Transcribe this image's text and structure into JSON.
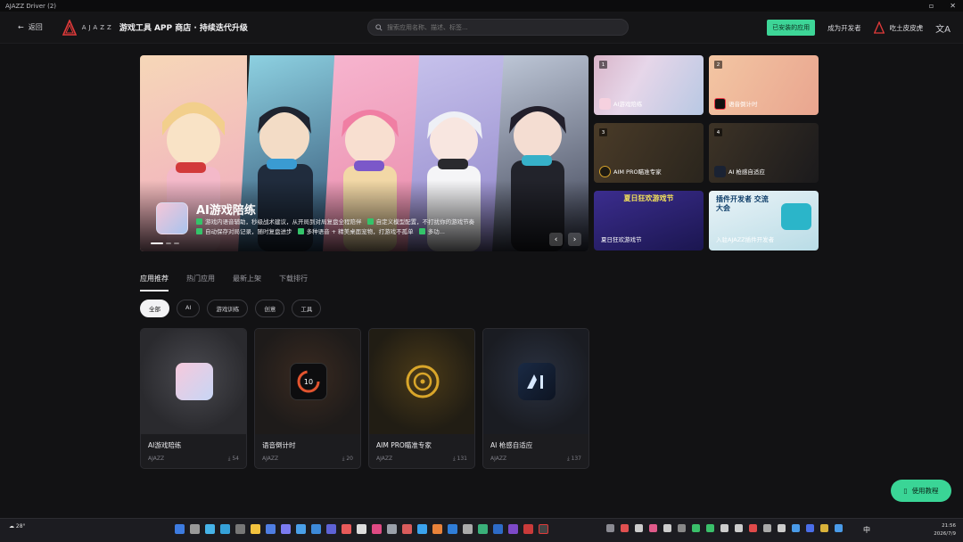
{
  "window": {
    "title": "AJAZZ Driver (2)",
    "controls": [
      "▫",
      "✕"
    ]
  },
  "header": {
    "back_label": "返回",
    "logo_word": "AJAZZ",
    "title": "游戏工具 APP 商店 · 持续迭代升级",
    "search_placeholder": "搜索应用名称、描述、标签...",
    "installed_label": "已安装的应用",
    "dev_label": "成为开发者",
    "user_name": "吃土皮皮虎",
    "lang_icon": "文A"
  },
  "hero": {
    "app_name": "AI游戏陪练",
    "features": [
      "游戏内语音辅助，秒级战术建议，从开局到对局复盘全程陪伴",
      "自定义模型配置，不打扰你的游戏节奏",
      "自动保存对局记录，随时复盘进步",
      "多种语音 + 精美桌面宠物，打游戏不孤单",
      "多功..."
    ],
    "prev_icon": "‹",
    "next_icon": "›",
    "colors": [
      "#f3c8cf",
      "#86c3d6",
      "#f2a9c4",
      "#c8b6e6",
      "#9fb2cc"
    ]
  },
  "side_cards": [
    {
      "index": "1",
      "label": "AI游戏陪练"
    },
    {
      "index": "2",
      "label": "语音倒计时"
    },
    {
      "index": "3",
      "label": "AIM PRO瞄准专家"
    },
    {
      "index": "4",
      "label": "AI 枪感自适应"
    },
    {
      "index": "",
      "label": "夏日狂欢游戏节",
      "banner": "夏日狂欢游戏节"
    },
    {
      "index": "",
      "label": "入驻AJAZZ插件开发者",
      "banner": "插件开发者 交流大会"
    }
  ],
  "tabs": [
    "应用推荐",
    "热门应用",
    "最新上架",
    "下载排行"
  ],
  "chips": [
    "全部",
    "AI",
    "游戏训练",
    "创意",
    "工具"
  ],
  "apps": [
    {
      "name": "AI游戏陪练",
      "publisher": "AJAZZ",
      "downloads": "54"
    },
    {
      "name": "语音倒计时",
      "publisher": "AJAZZ",
      "downloads": "20"
    },
    {
      "name": "AIM PRO瞄准专家",
      "publisher": "AJAZZ",
      "downloads": "131"
    },
    {
      "name": "AI 枪感自适应",
      "publisher": "AJAZZ",
      "downloads": "137"
    }
  ],
  "help_label": "使用教程",
  "taskbar": {
    "weather": "28°",
    "ime": "中",
    "clock_time": "21:56",
    "clock_date": "2026/7/9"
  }
}
